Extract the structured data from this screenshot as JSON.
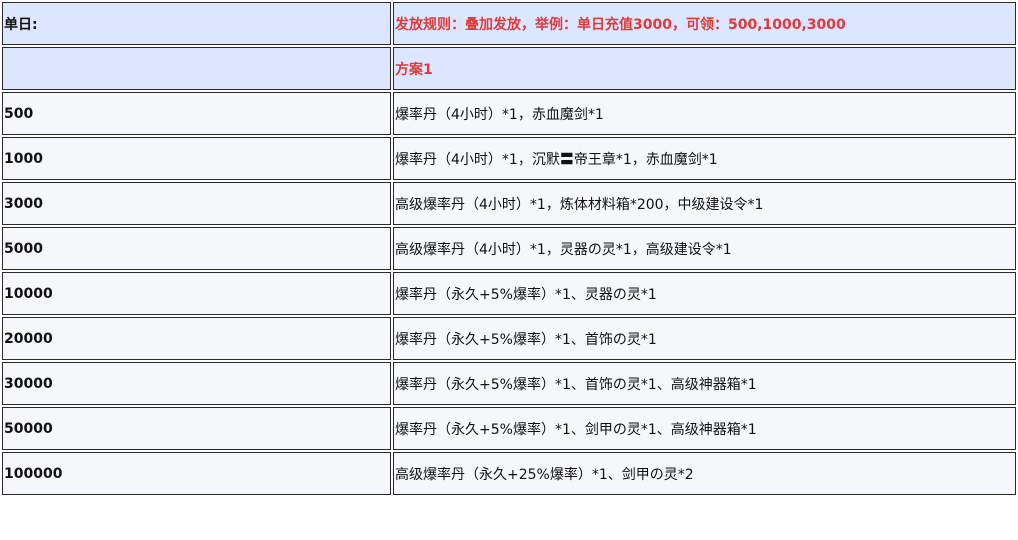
{
  "header": {
    "label": "单日:",
    "rule": "发放规则：叠加发放，举例：单日充值3000，可领：500,1000,3000",
    "blank": "",
    "plan": "方案1"
  },
  "rows": [
    {
      "amount": "500",
      "reward": "爆率丹（4小时）*1，赤血魔剑*1"
    },
    {
      "amount": "1000",
      "reward": "爆率丹（4小时）*1，沉默〓帝王章*1，赤血魔剑*1"
    },
    {
      "amount": "3000",
      "reward": "高级爆率丹（4小时）*1，炼体材料箱*200，中级建设令*1"
    },
    {
      "amount": "5000",
      "reward": "高级爆率丹（4小时）*1，灵器の灵*1，高级建设令*1"
    },
    {
      "amount": "10000",
      "reward": "爆率丹（永久+5%爆率）*1、灵器の灵*1"
    },
    {
      "amount": "20000",
      "reward": "爆率丹（永久+5%爆率）*1、首饰の灵*1"
    },
    {
      "amount": "30000",
      "reward": "爆率丹（永久+5%爆率）*1、首饰の灵*1、高级神器箱*1"
    },
    {
      "amount": "50000",
      "reward": "爆率丹（永久+5%爆率）*1、剑甲の灵*1、高级神器箱*1"
    },
    {
      "amount": "100000",
      "reward": "高级爆率丹（永久+25%爆率）*1、剑甲の灵*2"
    }
  ],
  "colors": {
    "header_bg": "#dde6ff",
    "row_bg": "#f5f7fa",
    "accent_red": "#e03a3a",
    "border": "#2a2a2a"
  }
}
